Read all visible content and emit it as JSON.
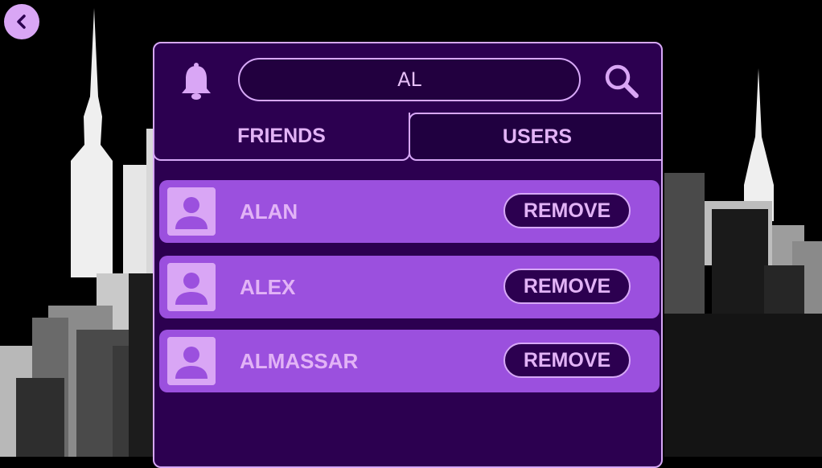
{
  "colors": {
    "panel_bg": "#2c0050",
    "panel_border": "#d7a8f7",
    "row_bg": "#9b50de",
    "text": "#e2b3f6",
    "background": "#000000"
  },
  "nav": {
    "back_icon": "chevron-left-icon"
  },
  "header": {
    "bell_icon": "bell-icon",
    "search_value": "AL",
    "search_icon": "search-icon"
  },
  "tabs": [
    {
      "label": "FRIENDS"
    },
    {
      "label": "USERS"
    }
  ],
  "users": [
    {
      "name": "ALAN",
      "action": "REMOVE"
    },
    {
      "name": "ALEX",
      "action": "REMOVE"
    },
    {
      "name": "ALMASSAR",
      "action": "REMOVE"
    }
  ]
}
